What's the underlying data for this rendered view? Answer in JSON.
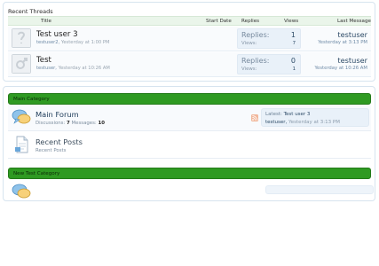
{
  "recent_threads": {
    "title": "Recent Threads",
    "columns": {
      "title": "Title",
      "start_date": "Start Date",
      "replies": "Replies",
      "views": "Views",
      "last_message": "Last Message"
    },
    "threads": [
      {
        "title": "Test user 3",
        "author": "testuser2",
        "date": "Yesterday at 1:00 PM",
        "replies_label": "Replies:",
        "replies": "1",
        "views_label": "Views:",
        "views": "7",
        "last_user": "testuser",
        "last_date": "Yesterday at 3:13 PM"
      },
      {
        "title": "Test",
        "author": "testuser",
        "date": "Yesterday at 10:26 AM",
        "replies_label": "Replies:",
        "replies": "0",
        "views_label": "Views:",
        "views": "1",
        "last_user": "testuser",
        "last_date": "Yesterday at 10:26 AM"
      }
    ]
  },
  "categories": [
    {
      "name": "Main Category",
      "forums": [
        {
          "title": "Main Forum",
          "discussions_label": "Discussions:",
          "discussions": "7",
          "messages_label": "Messages:",
          "messages": "10",
          "latest_label": "Latest:",
          "latest_thread": "Test user 3",
          "latest_user": "testuser",
          "latest_date": "Yesterday at 3:13 PM"
        },
        {
          "title": "Recent Posts",
          "subtitle": "Recent Posts"
        }
      ]
    },
    {
      "name": "New Test Category"
    }
  ],
  "colors": {
    "category_bar": "#2f9a22",
    "link": "#2d4b67",
    "stats_box": "#e9f1f9"
  },
  "icons": [
    "user-avatar-placeholder-icon",
    "forum-chat-bubbles-icon",
    "rss-feed-icon",
    "document-page-icon"
  ]
}
